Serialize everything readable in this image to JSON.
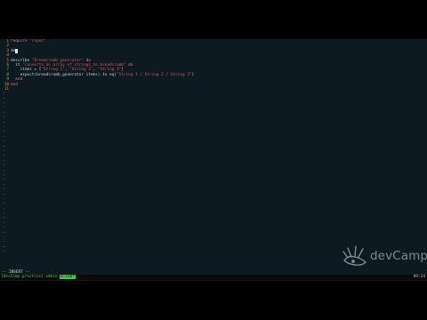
{
  "editor": {
    "code_lines": [
      {
        "num": "1",
        "parts": [
          {
            "t": "require ",
            "c": "kw"
          },
          {
            "t": "\"rspec\"",
            "c": "str"
          }
        ]
      },
      {
        "num": "2",
        "parts": []
      },
      {
        "num": "3",
        "parts": [
          {
            "t": "de",
            "c": "code"
          }
        ],
        "cursor": true
      },
      {
        "num": "4",
        "parts": []
      },
      {
        "num": "5",
        "parts": [
          {
            "t": "describe ",
            "c": "code"
          },
          {
            "t": "\"Breadcrumb generator\"",
            "c": "str"
          },
          {
            "t": " do",
            "c": "kw"
          }
        ]
      },
      {
        "num": "6",
        "parts": [
          {
            "t": "  it ",
            "c": "code"
          },
          {
            "t": "\"converts an array of strings to breadcrumb\"",
            "c": "str"
          },
          {
            "t": " do",
            "c": "kw"
          }
        ]
      },
      {
        "num": "7",
        "parts": [
          {
            "t": "    items = [",
            "c": "code"
          },
          {
            "t": "\"String 1\"",
            "c": "str"
          },
          {
            "t": ", ",
            "c": "code"
          },
          {
            "t": "\"String 2\"",
            "c": "str"
          },
          {
            "t": ", ",
            "c": "code"
          },
          {
            "t": "\"String 3\"",
            "c": "str"
          },
          {
            "t": "]",
            "c": "code"
          }
        ]
      },
      {
        "num": "8",
        "parts": [
          {
            "t": "    expect(breadcrumb_generator items).to eq(",
            "c": "code"
          },
          {
            "t": "\"String 1 / String 2 / String 3\"",
            "c": "str"
          },
          {
            "t": ")",
            "c": "code"
          }
        ]
      },
      {
        "num": "9",
        "parts": [
          {
            "t": "  end",
            "c": "kw"
          }
        ]
      },
      {
        "num": "10",
        "parts": [
          {
            "t": "end",
            "c": "kw"
          }
        ]
      },
      {
        "num": "11",
        "parts": []
      }
    ],
    "tilde_count": 34,
    "tilde_char": "~"
  },
  "mode": {
    "text": "-- INSERT --"
  },
  "status": {
    "left_text": "[devCamp-practice] ",
    "session": "admin",
    "active_window": "0:vim*",
    "right_text": "09:24"
  },
  "logo": {
    "text": "devCamp",
    "icon": "knife-multitool-icon"
  },
  "colors": {
    "editor_bg": "#0d1a22",
    "line_number": "#c7a34a",
    "keyword": "#e07a9a",
    "string": "#d9574e",
    "tilde": "#3f5a8a",
    "status_green": "#4ec24a"
  }
}
